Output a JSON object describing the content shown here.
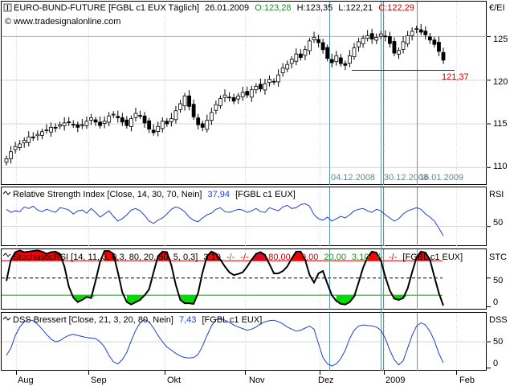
{
  "colors": {
    "up": "#2a8a2a",
    "down": "#cc0000",
    "rsi_line": "#1f3fcf",
    "vline": "#5a9aa8",
    "support": "#cc0000",
    "grid": "#d4d4d4",
    "hline": "#8fbf8f"
  },
  "main_panel": {
    "title": "EURO-BUND-FUTURE [FGBL c1 EUX  Täglich]",
    "date": "26.01.2009",
    "o_label": "O:",
    "o_value": "123,28",
    "h_label": "H:",
    "h_value": "123,35",
    "l_label": "L:",
    "l_value": "122,21",
    "c_label": "C:",
    "c_value": "122,29",
    "watermark": "© www.tradesignalonline.com",
    "currency": "€/EI",
    "y_ticks": [
      "125",
      "120",
      "115",
      "110"
    ],
    "support_label": "121,37",
    "date_markers": [
      "04.12.2008",
      "30.12.2008",
      "16.01.2009"
    ]
  },
  "chart_data": [
    {
      "type": "candlestick",
      "title": "EURO-BUND-FUTURE [FGBL c1 EUX  Täglich]",
      "x_tick_labels": [
        "Aug",
        "Sep",
        "Okt",
        "Nov",
        "Dez",
        "2009",
        "Feb"
      ],
      "y_tick_labels": [
        "125",
        "120",
        "115",
        "110"
      ],
      "ylim": [
        108,
        129
      ],
      "support_level": 121.37,
      "last": {
        "open": 123.28,
        "high": 123.35,
        "low": 122.21,
        "close": 122.29
      },
      "closes": [
        111.0,
        111.8,
        112.4,
        112.7,
        113.1,
        113.5,
        113.4,
        113.8,
        114.1,
        114.3,
        114.6,
        114.5,
        114.9,
        115.1,
        115.2,
        114.9,
        114.6,
        114.9,
        115.3,
        115.7,
        115.2,
        114.8,
        115.3,
        115.9,
        116.1,
        115.7,
        115.2,
        114.8,
        115.6,
        116.2,
        115.9,
        115.1,
        114.4,
        114.0,
        114.7,
        115.3,
        115.0,
        115.6,
        116.5,
        117.3,
        118.2,
        117.0,
        115.8,
        114.9,
        114.6,
        115.4,
        116.3,
        117.2,
        117.9,
        118.3,
        118.0,
        117.6,
        118.2,
        118.6,
        118.3,
        118.9,
        119.3,
        119.0,
        119.6,
        120.1,
        119.8,
        120.6,
        121.4,
        121.8,
        122.4,
        123.0,
        122.6,
        123.5,
        124.5,
        124.9,
        124.3,
        123.5,
        122.5,
        122.0,
        122.8,
        121.9,
        121.7,
        122.8,
        123.7,
        124.4,
        124.8,
        125.1,
        124.7,
        124.9,
        125.3,
        125.0,
        124.2,
        123.1,
        123.4,
        124.4,
        125.1,
        125.6,
        125.9,
        125.5,
        125.2,
        124.6,
        124.1,
        123.3,
        122.3
      ]
    },
    {
      "type": "line",
      "title": "Relative Strength Index [Close, 14, 30, 70, Nein]",
      "last_value": "37,94",
      "y_tick_labels": [
        "50"
      ],
      "ylim": [
        25,
        100
      ],
      "values": [
        72,
        68,
        70,
        69,
        75,
        73,
        76,
        71,
        69,
        72,
        70,
        68,
        74,
        73,
        71,
        66,
        70,
        71,
        67,
        73,
        68,
        62,
        66,
        70,
        63,
        57,
        60,
        65,
        71,
        73,
        70,
        64,
        57,
        54,
        58,
        61,
        66,
        72,
        75,
        73,
        69,
        62,
        58,
        56,
        61,
        65,
        67,
        72,
        74,
        69,
        68,
        70,
        72,
        71,
        68,
        70,
        73,
        69,
        68,
        74,
        72,
        70,
        75,
        77,
        73,
        74,
        78,
        79,
        76,
        65,
        60,
        58,
        62,
        57,
        60,
        63,
        61,
        65,
        70,
        72,
        73,
        70,
        68,
        72,
        70,
        65,
        61,
        57,
        60,
        66,
        70,
        72,
        74,
        72,
        66,
        62,
        57,
        48,
        38
      ]
    },
    {
      "type": "line",
      "title": "StochasticRSI [14, 11, 3, 0,3, 80, 20, 50, 5, 0,3]",
      "y_tick_labels": [
        "50",
        "0"
      ],
      "ylim": [
        -5,
        100
      ],
      "levels": [
        80,
        50,
        20
      ],
      "values": [
        45,
        82,
        95,
        98,
        95,
        96,
        97,
        98,
        96,
        92,
        95,
        96,
        92,
        70,
        35,
        16,
        8,
        12,
        17,
        15,
        45,
        78,
        97,
        97,
        92,
        60,
        25,
        8,
        4,
        8,
        12,
        20,
        30,
        60,
        88,
        96,
        95,
        72,
        38,
        12,
        6,
        6,
        5,
        24,
        60,
        88,
        96,
        92,
        82,
        70,
        60,
        55,
        57,
        60,
        70,
        82,
        92,
        95,
        90,
        74,
        58,
        58,
        62,
        70,
        84,
        96,
        96,
        82,
        55,
        42,
        58,
        62,
        40,
        20,
        10,
        5,
        4,
        8,
        18,
        42,
        68,
        86,
        96,
        94,
        80,
        52,
        28,
        14,
        12,
        15,
        32,
        60,
        86,
        96,
        94,
        82,
        52,
        24,
        2
      ]
    },
    {
      "type": "line",
      "title": "DSS Bressert [Close, 21, 3, 20, 80, Nein]",
      "last_value": "7,43",
      "y_tick_labels": [
        "50",
        "0"
      ],
      "ylim": [
        -5,
        105
      ],
      "values": [
        24,
        38,
        62,
        78,
        88,
        92,
        90,
        83,
        74,
        64,
        55,
        50,
        52,
        58,
        62,
        64,
        62,
        60,
        58,
        57,
        56,
        50,
        40,
        24,
        12,
        8,
        16,
        30,
        52,
        72,
        86,
        92,
        88,
        76,
        62,
        50,
        40,
        34,
        28,
        23,
        20,
        19,
        20,
        26,
        42,
        62,
        80,
        92,
        94,
        91,
        87,
        82,
        78,
        75,
        72,
        74,
        78,
        84,
        88,
        90,
        91,
        88,
        84,
        78,
        74,
        70,
        72,
        76,
        80,
        74,
        46,
        20,
        8,
        4,
        8,
        18,
        34,
        56,
        72,
        80,
        82,
        81,
        80,
        78,
        72,
        56,
        34,
        16,
        6,
        14,
        38,
        62,
        80,
        86,
        82,
        70,
        52,
        28,
        10
      ]
    }
  ],
  "rsi_panel": {
    "title": "Relative Strength Index [Close, 14, 30, 70, Nein]",
    "value": "37,94",
    "symbol": "[FGBL c1 EUX]",
    "side_label": "RSI",
    "y_tick": "50"
  },
  "stoch_panel": {
    "title": "StochasticRSI [14, 11, 3, 0,3, 80, 20, 50, 5, 0,3]",
    "v1": "3,10",
    "v2": "-/-",
    "v3": "-/-",
    "v4": "-/-",
    "v5": "80,00",
    "v6": "80,00",
    "v7": "20,00",
    "v8": "3,10",
    "v9": "-/-",
    "v10": "-/-",
    "symbol": "[FGBL c1 EUX]",
    "side_label": "STC",
    "y_ticks": [
      "50",
      "0"
    ]
  },
  "dss_panel": {
    "title": "DSS Bressert [Close, 21, 3, 20, 80, Nein]",
    "value": "7,43",
    "symbol": "[FGBL c1 EUX]",
    "side_label": "DSS",
    "y_ticks": [
      "50",
      "0"
    ]
  },
  "x_axis": {
    "months": [
      "Aug",
      "Sep",
      "Okt",
      "Nov",
      "Dez",
      "2009",
      "Feb"
    ]
  }
}
